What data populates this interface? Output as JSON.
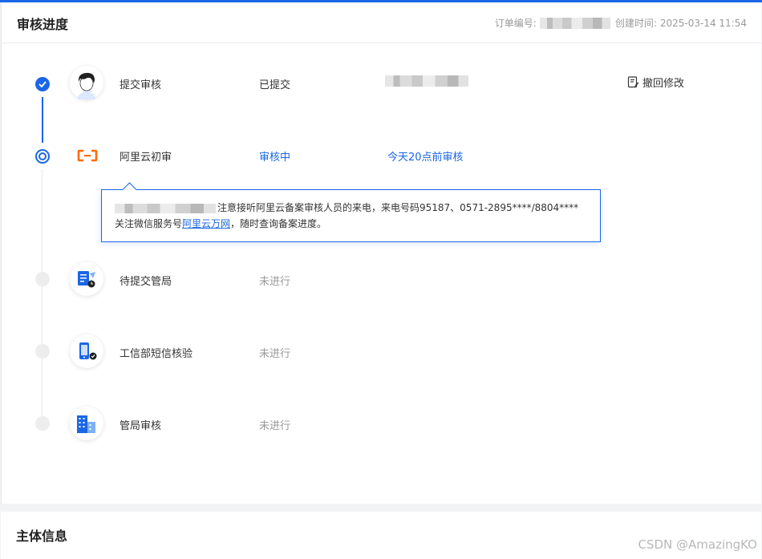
{
  "header": {
    "title": "审核进度",
    "order_label": "订单编号:",
    "created_label": "创建时间:",
    "created_time": "2025-03-14 11:54"
  },
  "steps": [
    {
      "label": "提交审核",
      "status": "已提交",
      "icon": "user-avatar-icon",
      "state": "done"
    },
    {
      "label": "阿里云初审",
      "status": "审核中",
      "extra": "今天20点前审核",
      "icon": "aliyun-logo-icon",
      "state": "current"
    },
    {
      "label": "待提交管局",
      "status": "未进行",
      "icon": "document-clock-icon",
      "state": "todo"
    },
    {
      "label": "工信部短信核验",
      "status": "未进行",
      "icon": "phone-check-icon",
      "state": "todo"
    },
    {
      "label": "管局审核",
      "status": "未进行",
      "icon": "building-icon",
      "state": "todo"
    }
  ],
  "withdraw_label": "撤回修改",
  "tooltip": {
    "line1": "注意接听阿里云备案审核人员的来电，来电号码95187、0571-2895****/8804****",
    "line2_prefix": "关注微信服务号",
    "link": "阿里云万网",
    "line2_suffix": "，随时查询备案进度。"
  },
  "section2_title": "主体信息",
  "watermark": "CSDN @AmazingKO",
  "colors": {
    "accent": "#1a66e6",
    "aliyun_orange": "#ff6a00"
  }
}
